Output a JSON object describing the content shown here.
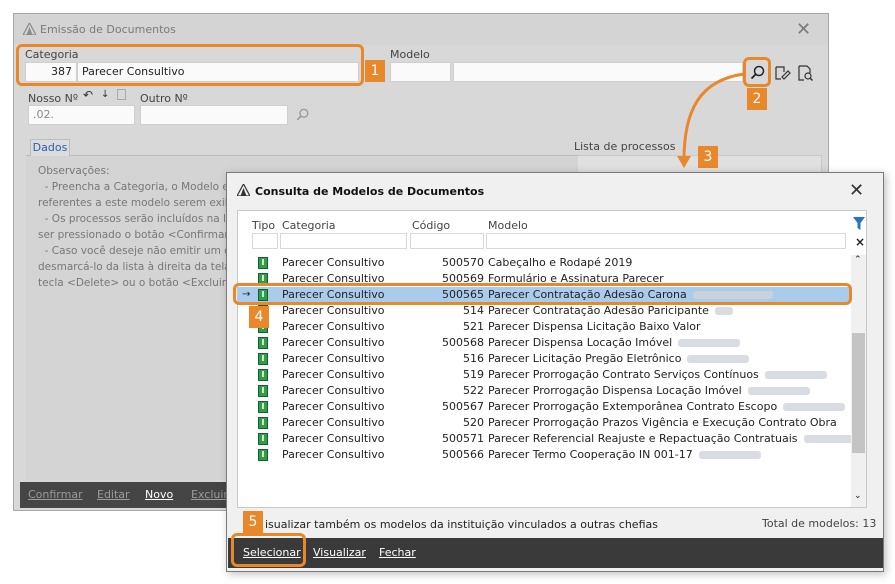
{
  "main_window": {
    "title": "Emissão de Documentos",
    "categoria_label": "Categoria",
    "categoria_code": "387",
    "categoria_name": "Parecer Consultivo",
    "modelo_label": "Modelo",
    "nosso_label": "Nosso Nº",
    "nosso_value": ".02.",
    "outro_label": "Outro Nº",
    "lista_label": "Lista de processos",
    "tab_label": "Dados",
    "observations": "Observações:\n  - Preencha a Categoria, o Modelo e\nreferentes a este modelo serem exib\n  - Os processos serão incluídos na lis\nser pressionado o botão <Confirmar\n  - Caso você deseje não emitir um do\ndesmarcá-lo da lista à direita da tela\ntecla <Delete> ou o botão <Excluir>",
    "footer": [
      "Confirmar",
      "Editar",
      "Novo",
      "Excluir"
    ]
  },
  "modal": {
    "title": "Consulta de Modelos de Documentos",
    "columns": [
      "Tipo",
      "Categoria",
      "Código",
      "Modelo"
    ],
    "rows": [
      {
        "categoria": "Parecer Consultivo",
        "codigo": "500570",
        "modelo": "Cabeçalho e Rodapé 2019",
        "blur": 0
      },
      {
        "categoria": "Parecer Consultivo",
        "codigo": "500569",
        "modelo": "Formulário e Assinatura Parecer",
        "blur": 0
      },
      {
        "categoria": "Parecer Consultivo",
        "codigo": "500565",
        "modelo": "Parecer Contratação Adesão Carona",
        "blur": 80
      },
      {
        "categoria": "Parecer Consultivo",
        "codigo": "514",
        "modelo": "Parecer Contratação Adesão Paricipante",
        "blur": 18
      },
      {
        "categoria": "Parecer Consultivo",
        "codigo": "521",
        "modelo": "Parecer Dispensa Licitação Baixo Valor",
        "blur": 0
      },
      {
        "categoria": "Parecer Consultivo",
        "codigo": "500568",
        "modelo": "Parecer Dispensa Locação Imóvel",
        "blur": 62
      },
      {
        "categoria": "Parecer Consultivo",
        "codigo": "516",
        "modelo": "Parecer Licitação Pregão Eletrônico",
        "blur": 62
      },
      {
        "categoria": "Parecer Consultivo",
        "codigo": "519",
        "modelo": "Parecer Prorrogação Contrato Serviços Contínuos",
        "blur": 62
      },
      {
        "categoria": "Parecer Consultivo",
        "codigo": "522",
        "modelo": "Parecer Prorrogação Dispensa Locação Imóvel",
        "blur": 62
      },
      {
        "categoria": "Parecer Consultivo",
        "codigo": "500567",
        "modelo": "Parecer Prorrogação Extemporânea Contrato Escopo",
        "blur": 62
      },
      {
        "categoria": "Parecer Consultivo",
        "codigo": "520",
        "modelo": "Parecer Prorrogação Prazos Vigência e Execução Contrato Obra",
        "blur": 0
      },
      {
        "categoria": "Parecer Consultivo",
        "codigo": "500571",
        "modelo": "Parecer Referencial Reajuste e Repactuação Contratuais",
        "blur": 62
      },
      {
        "categoria": "Parecer Consultivo",
        "codigo": "500566",
        "modelo": "Parecer Termo Cooperação IN 001-17",
        "blur": 62
      }
    ],
    "selected_index": 2,
    "checkbox_label": "isualizar também os modelos da instituição vinculados a outras chefias",
    "total_label": "Total de modelos: 13",
    "footer": [
      "Selecionar",
      "Visualizar",
      "Fechar"
    ]
  },
  "badges": [
    "1",
    "2",
    "3",
    "4",
    "5"
  ],
  "colors": {
    "accent": "#e8882b",
    "selected_row": "#a9ccec",
    "type_icon": "#2e9e4a"
  }
}
